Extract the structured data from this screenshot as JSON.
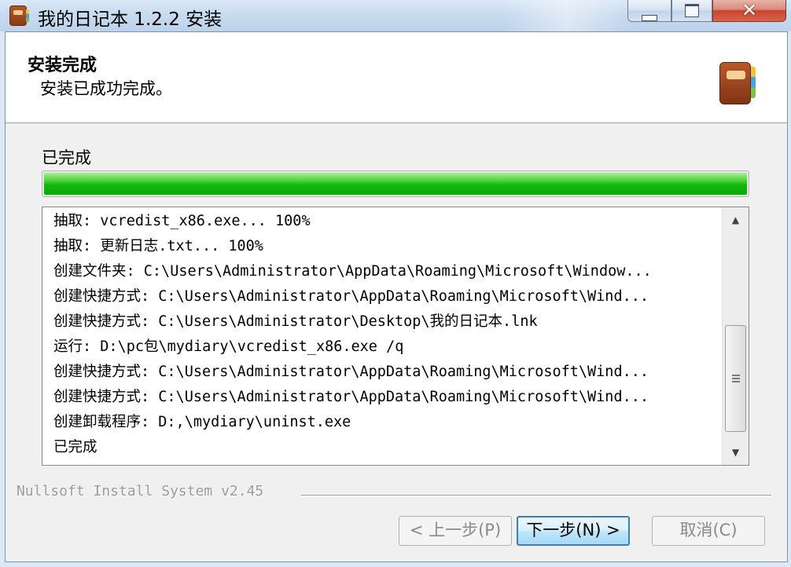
{
  "window": {
    "title": "我的日记本 1.2.2 安装",
    "minimize_glyph": "",
    "close_glyph": "✕"
  },
  "header": {
    "title": "安装完成",
    "subtitle": "安装已成功完成。"
  },
  "progress": {
    "label": "已完成",
    "value_percent": 100
  },
  "log": {
    "lines": [
      "抽取: vcredist_x86.exe... 100%",
      "抽取: 更新日志.txt... 100%",
      "创建文件夹: C:\\Users\\Administrator\\AppData\\Roaming\\Microsoft\\Window...",
      "创建快捷方式: C:\\Users\\Administrator\\AppData\\Roaming\\Microsoft\\Wind...",
      "创建快捷方式: C:\\Users\\Administrator\\Desktop\\我的日记本.lnk",
      "运行: D:\\pc包\\mydiary\\vcredist_x86.exe /q",
      "创建快捷方式: C:\\Users\\Administrator\\AppData\\Roaming\\Microsoft\\Wind...",
      "创建快捷方式: C:\\Users\\Administrator\\AppData\\Roaming\\Microsoft\\Wind...",
      "创建卸载程序: D:,\\mydiary\\uninst.exe",
      "已完成"
    ],
    "scroll_up_glyph": "▲",
    "scroll_down_glyph": "▼"
  },
  "footer": {
    "branding": "Nullsoft Install System v2.45",
    "back_label": "< 上一步(P)",
    "next_label": "下一步(N) >",
    "cancel_label": "取消(C)"
  }
}
